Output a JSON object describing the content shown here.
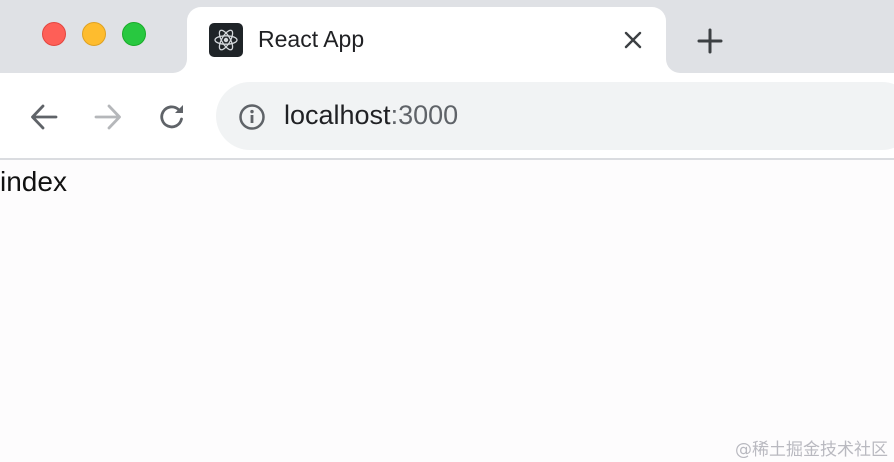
{
  "window": {
    "controls": [
      "close",
      "minimize",
      "zoom"
    ]
  },
  "tab": {
    "title": "React App",
    "favicon": "react-logo-icon",
    "close_icon": "close-icon"
  },
  "new_tab": {
    "icon": "plus-icon"
  },
  "toolbar": {
    "back_icon": "arrow-left-icon",
    "forward_icon": "arrow-right-icon",
    "reload_icon": "reload-icon"
  },
  "address_bar": {
    "security_icon": "info-icon",
    "host": "localhost",
    "port": ":3000"
  },
  "page": {
    "text": "index"
  },
  "watermark": {
    "text": "@稀土掘金技术社区"
  },
  "colors": {
    "close": "#fe5f57",
    "minimize": "#febc2e",
    "zoom": "#28c840",
    "tabstrip": "#dfe1e5",
    "omnibox": "#f1f3f4",
    "favicon_bg": "#1f2428",
    "react_blue": "#61dafb"
  }
}
